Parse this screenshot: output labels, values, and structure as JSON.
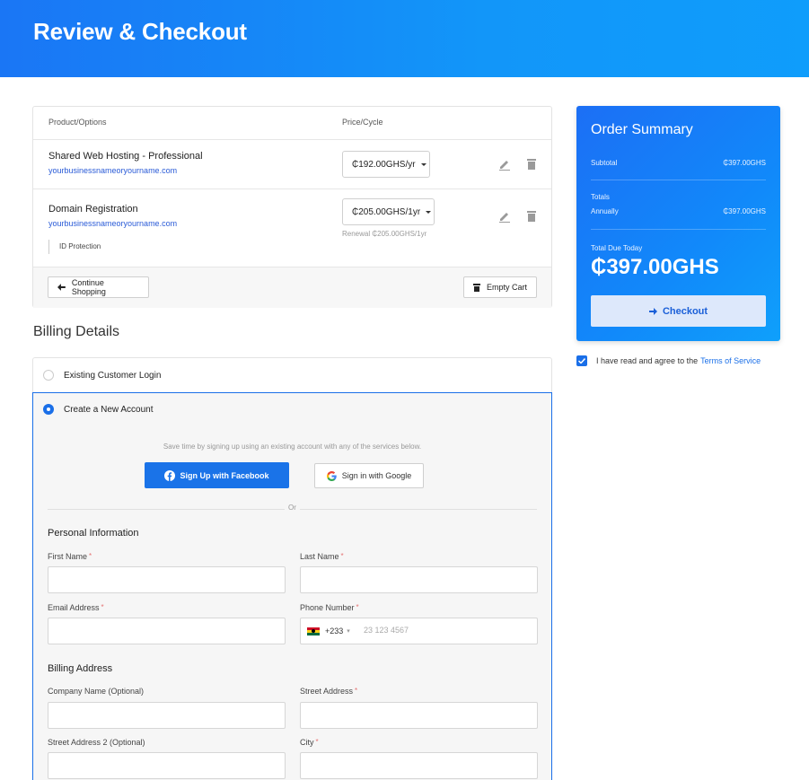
{
  "header": {
    "title": "Review & Checkout"
  },
  "cart": {
    "columns": {
      "product": "Product/Options",
      "price": "Price/Cycle"
    },
    "items": [
      {
        "name": "Shared Web Hosting - Professional",
        "domain": "yourbusinessnameoryourname.com",
        "price": "₵192.00GHS/yr"
      },
      {
        "name": "Domain Registration",
        "domain": "yourbusinessnameoryourname.com",
        "price": "₵205.00GHS/1yr",
        "renewal": "Renewal ₵205.00GHS/1yr",
        "addon": "ID Protection"
      }
    ],
    "continue_label": "Continue Shopping",
    "empty_label": "Empty Cart"
  },
  "summary": {
    "title": "Order Summary",
    "subtotal_label": "Subtotal",
    "subtotal_value": "₵397.00GHS",
    "totals_label": "Totals",
    "annually_label": "Annually",
    "annually_value": "₵397.00GHS",
    "due_label": "Total Due Today",
    "due_value": "₵397.00GHS",
    "checkout_label": "Checkout"
  },
  "tos": {
    "text": "I have read and agree to the",
    "link": "Terms of Service"
  },
  "billing": {
    "title": "Billing Details",
    "existing_label": "Existing Customer Login",
    "new_label": "Create a New Account",
    "hint": "Save time by signing up using an existing account with any of the services below.",
    "facebook_label": "Sign Up with Facebook",
    "google_label": "Sign in with Google",
    "or_label": "Or",
    "personal_title": "Personal Information",
    "first_name": "First Name",
    "last_name": "Last Name",
    "email": "Email Address",
    "phone": "Phone Number",
    "phone_code": "+233",
    "phone_placeholder": "23 123 4567",
    "address_title": "Billing Address",
    "company": "Company Name (Optional)",
    "street": "Street Address",
    "street2": "Street Address 2 (Optional)",
    "city": "City",
    "required_mark": "*"
  },
  "colors": {
    "accent": "#1a6fe8",
    "header": "#1a76f5"
  }
}
